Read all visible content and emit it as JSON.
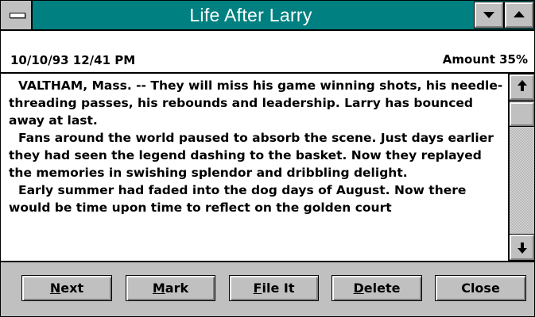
{
  "window": {
    "title": "Life After Larry",
    "colors": {
      "title_bar": "#008080",
      "chrome": "#c0c0c0"
    }
  },
  "info": {
    "datetime": "10/10/93 12/41 PM",
    "amount": "Amount  35%"
  },
  "article": {
    "paragraphs": [
      "VALTHAM, Mass.   -- They will miss his game winning shots, his needle-threading passes, his rebounds and leadership.  Larry has bounced away at last.",
      "Fans around the world paused to absorb the scene.  Just days earlier they had seen the legend dashing to the basket. Now they replayed the memories in swishing splendor and dribbling delight.",
      "Early summer had faded into the dog days of August.  Now there would be time upon time to reflect on the golden court"
    ]
  },
  "buttons": {
    "next": {
      "hotkey": "N",
      "rest": "ext"
    },
    "mark": {
      "hotkey": "M",
      "rest": "ark"
    },
    "fileit": {
      "hotkey": "F",
      "rest": "ile It"
    },
    "delete": {
      "hotkey": "D",
      "rest": "elete"
    },
    "close": {
      "label": "Close"
    }
  },
  "icons": {
    "system_menu": "system-menu-icon",
    "minimize": "minimize-icon",
    "maximize": "maximize-icon",
    "scroll_up": "scroll-up-arrow-icon",
    "scroll_down": "scroll-down-arrow-icon"
  }
}
